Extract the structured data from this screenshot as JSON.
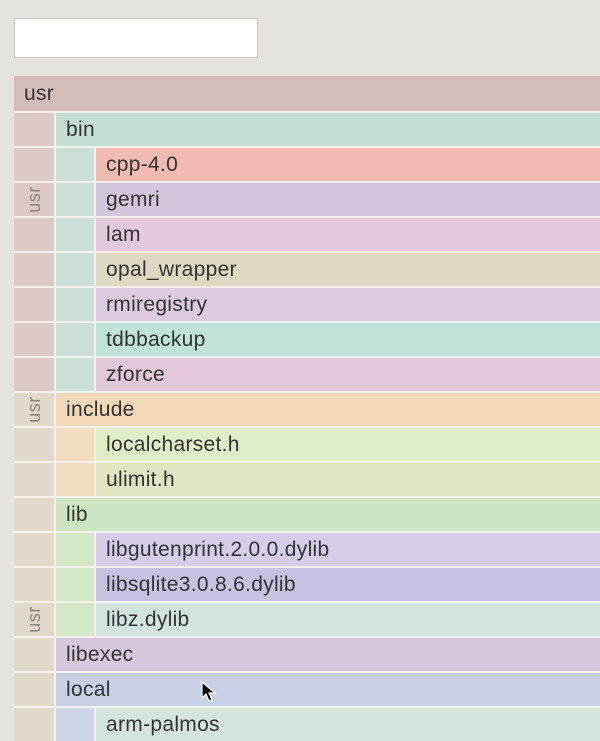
{
  "search": {
    "placeholder": "",
    "value": ""
  },
  "gutter": {
    "usr": "usr"
  },
  "tree": {
    "root": {
      "label": "usr"
    },
    "bin": {
      "label": "bin",
      "children": [
        "cpp-4.0",
        "gemri",
        "lam",
        "opal_wrapper",
        "rmiregistry",
        "tdbbackup",
        "zforce"
      ]
    },
    "include": {
      "label": "include",
      "children": [
        "localcharset.h",
        "ulimit.h"
      ]
    },
    "lib": {
      "label": "lib",
      "children": [
        "libgutenprint.2.0.0.dylib",
        "libsqlite3.0.8.6.dylib",
        "libz.dylib"
      ]
    },
    "libexec": {
      "label": "libexec"
    },
    "local": {
      "label": "local",
      "children": [
        "arm-palmos"
      ]
    }
  },
  "colors": {
    "body_bg": "#e6e2de",
    "root": "#d3bdbc",
    "gutter_root": "#ddcac7",
    "gutter_usr": "#e0d9cc",
    "bin": "#c6dfd5",
    "bin_label": "#cce0d9",
    "cpp": "#f1bbb2",
    "gemri": "#d3c6dc",
    "lam": "#e4c8dc",
    "opal": "#ded9c2",
    "rmi": "#dccae0",
    "tdb": "#c1e4d9",
    "zforce": "#e2c8d9",
    "include": "#f1d8b8",
    "include_label": "#f4ddbe",
    "localcharset": "#e0eec8",
    "ulimit": "#e3e4c2",
    "lib": "#cfe6c2",
    "lib_label": "#d4e8c8",
    "libguten": "#d7ccea",
    "libsqlite": "#c6c3e2",
    "libz": "#d2e3e2",
    "libexec": "#d6c8dd",
    "local": "#c7d0e4",
    "local_label": "#cdd5e7",
    "arm": "#d5e4dd"
  }
}
